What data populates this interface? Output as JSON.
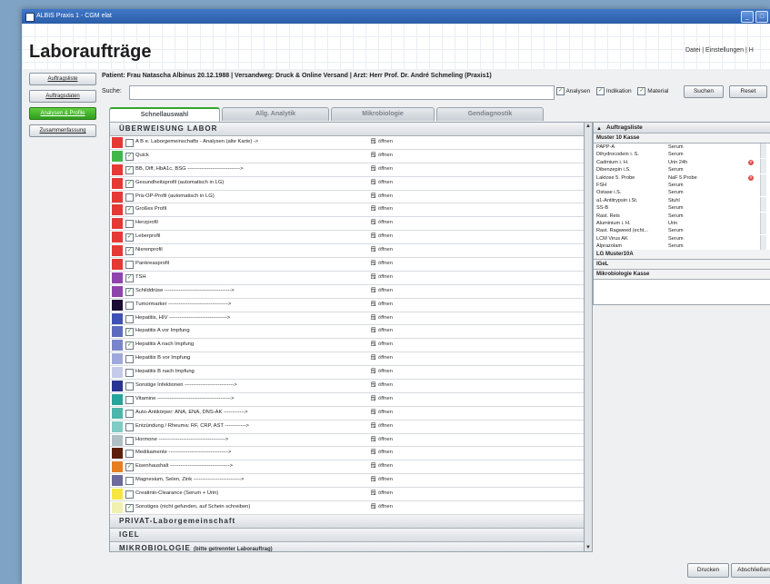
{
  "window": {
    "title": "ALBIS Praxis 1 - CGM elat",
    "buttons": [
      "_",
      "□"
    ]
  },
  "page_title": "Laboraufträge",
  "top_menu": "Datei | Einstellungen | H",
  "nav": [
    {
      "label": "Auftragsliste",
      "active": false
    },
    {
      "label": "Auftragsdaten",
      "active": false
    },
    {
      "label": "Analysen & Profile",
      "active": true
    },
    {
      "label": "Zusammenfassung",
      "active": false
    }
  ],
  "patient_line": "Patient: Frau Natascha Albinus 20.12.1988 | Versandweg: Druck & Online Versand | Arzt: Herr Prof. Dr. André Schmeling (Praxis1)",
  "search": {
    "label": "Suche:",
    "value": "",
    "options": [
      "Analysen",
      "Indikation",
      "Material"
    ],
    "search_button": "Suchen",
    "reset_button": "Reset"
  },
  "tabs": [
    "Schnellauswahl",
    "Allg. Analytik",
    "Mikrobiologie",
    "Gendiagnostik"
  ],
  "section_main": "ÜBERWEISUNG LABOR",
  "open_label": "öffnen",
  "rows": [
    {
      "color": "#e53935",
      "checked": false,
      "label": "A B e. Laborgemeinschafts - Analysen (alte Karte) ->"
    },
    {
      "color": "#43b649",
      "checked": true,
      "label": "Quick"
    },
    {
      "color": "#e53935",
      "checked": true,
      "label": "BB, Diff, HbA1c, BSG ------------------------------>"
    },
    {
      "color": "#e53935",
      "checked": true,
      "label": "Gesundheitsprofil (automatisch in LG)"
    },
    {
      "color": "#e53935",
      "checked": false,
      "label": "Prä-OP-Profil (automatisch in LG)"
    },
    {
      "color": "#e53935",
      "checked": true,
      "label": "Großes Profil"
    },
    {
      "color": "#e53935",
      "checked": false,
      "label": "Herzprofil"
    },
    {
      "color": "#e53935",
      "checked": true,
      "label": "Leberprofil"
    },
    {
      "color": "#e53935",
      "checked": true,
      "label": "Nierenprofil"
    },
    {
      "color": "#e53935",
      "checked": false,
      "label": "Pankreasprofil"
    },
    {
      "color": "#8e44ad",
      "checked": true,
      "label": "TSH"
    },
    {
      "color": "#8e44ad",
      "checked": true,
      "label": "Schilddrüse -------------------------------------->"
    },
    {
      "color": "#1a0d33",
      "checked": false,
      "label": "Tumormarker ---------------------------------->"
    },
    {
      "color": "#3f51b5",
      "checked": false,
      "label": "Hepatitis, HIV --------------------------------->"
    },
    {
      "color": "#5c6bc0",
      "checked": true,
      "label": "Hepatitis A vor Impfung"
    },
    {
      "color": "#7986cb",
      "checked": true,
      "label": "Hepatitis A nach Impfung"
    },
    {
      "color": "#9fa8da",
      "checked": false,
      "label": "Hepatitis B vor Impfung"
    },
    {
      "color": "#c5cae9",
      "checked": false,
      "label": "Hepatitis B nach Impfung"
    },
    {
      "color": "#283593",
      "checked": false,
      "label": "Sonstige Infektionen ---------------------------->"
    },
    {
      "color": "#26a69a",
      "checked": false,
      "label": "Vitamine ------------------------------------------>"
    },
    {
      "color": "#4db6ac",
      "checked": false,
      "label": "Auto-Antikörper: ANA, ENA, DNS-AK ------------>"
    },
    {
      "color": "#80cbc4",
      "checked": false,
      "label": "Entzündung / Rheuma: RF, CRP, AST ------------>"
    },
    {
      "color": "#b0bec5",
      "checked": false,
      "label": "Hormone -------------------------------------->"
    },
    {
      "color": "#5d1f0c",
      "checked": false,
      "label": "Medikamente ---------------------------------->"
    },
    {
      "color": "#e67e22",
      "checked": true,
      "label": "Eisenhaushalt ---------------------------------->"
    },
    {
      "color": "#6d6a9c",
      "checked": false,
      "label": "Magnesium, Selen, Zink --------------------------->"
    },
    {
      "color": "#f5e642",
      "checked": false,
      "label": "Creatinin-Clearance (Serum + Urin)"
    },
    {
      "color": "#f0f0b0",
      "checked": true,
      "label": "Sonstiges (nicht gefunden, auf Schein schreiben)"
    }
  ],
  "sections_more": [
    {
      "label": "PRIVAT-Laborgemeinschaft",
      "note": ""
    },
    {
      "label": "IGEL",
      "note": ""
    },
    {
      "label": "MIKROBIOLOGIE",
      "note": "(bitte getrennter Laborauftrag)"
    }
  ],
  "orders": {
    "title": "Auftragsliste",
    "group": "Muster 10 Kasse",
    "items": [
      {
        "analysis": "PAPP-A",
        "material": "Serum",
        "delete": false
      },
      {
        "analysis": "Dihydrocodein i. S.",
        "material": "Serum",
        "delete": false
      },
      {
        "analysis": "Cadmium i. H.",
        "material": "Urin 24h",
        "delete": true
      },
      {
        "analysis": "Dibenzepin i.S.",
        "material": "Serum",
        "delete": false
      },
      {
        "analysis": "Laktose 5. Probe",
        "material": "NaF 5.Probe",
        "delete": true
      },
      {
        "analysis": "FSH",
        "material": "Serum",
        "delete": false
      },
      {
        "analysis": "Ostase i.S.",
        "material": "Serum",
        "delete": false
      },
      {
        "analysis": "a1-Antitrypsin i.St.",
        "material": "Stuhl",
        "delete": false
      },
      {
        "analysis": "SS-B",
        "material": "Serum",
        "delete": false
      },
      {
        "analysis": "Rast. Reis",
        "material": "Serum",
        "delete": false
      },
      {
        "analysis": "Aluminium i. H.",
        "material": "Urin",
        "delete": false
      },
      {
        "analysis": "Rast. Ragweed (echt...",
        "material": "Serum",
        "delete": false
      },
      {
        "analysis": "LCM Virus AK",
        "material": "Serum",
        "delete": false
      },
      {
        "analysis": "Alprazolam",
        "material": "Serum",
        "delete": false
      }
    ],
    "groups_more": [
      "LG Muster10A",
      "IGeL",
      "Mikrobiologie Kasse"
    ]
  },
  "bottom_buttons": [
    "Drucken",
    "Abschließen"
  ]
}
